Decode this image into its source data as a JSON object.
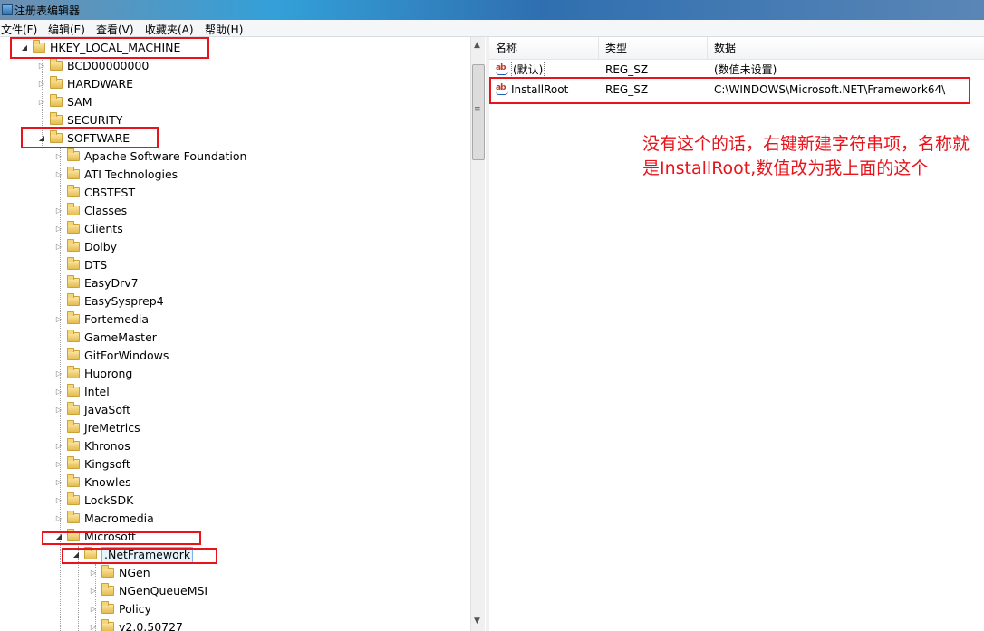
{
  "window": {
    "title": "注册表编辑器"
  },
  "menu": [
    "文件(F)",
    "编辑(E)",
    "查看(V)",
    "收藏夹(A)",
    "帮助(H)"
  ],
  "tree": {
    "root": "HKEY_LOCAL_MACHINE",
    "level1": [
      "BCD00000000",
      "HARDWARE",
      "SAM",
      "SECURITY",
      "SOFTWARE"
    ],
    "software_children": [
      "Apache Software Foundation",
      "ATI Technologies",
      "CBSTEST",
      "Classes",
      "Clients",
      "Dolby",
      "DTS",
      "EasyDrv7",
      "EasySysprep4",
      "Fortemedia",
      "GameMaster",
      "GitForWindows",
      "Huorong",
      "Intel",
      "JavaSoft",
      "JreMetrics",
      "Khronos",
      "Kingsoft",
      "Knowles",
      "LockSDK",
      "Macromedia",
      "Microsoft"
    ],
    "microsoft_children": [
      ".NetFramework"
    ],
    "netframework_children": [
      "NGen",
      "NGenQueueMSI",
      "Policy",
      "v2.0.50727"
    ]
  },
  "list": {
    "columns": [
      "名称",
      "类型",
      "数据"
    ],
    "rows": [
      {
        "name": "(默认)",
        "type": "REG_SZ",
        "data": "(数值未设置)"
      },
      {
        "name": "InstallRoot",
        "type": "REG_SZ",
        "data": "C:\\WINDOWS\\Microsoft.NET\\Framework64\\"
      }
    ]
  },
  "annotation": "没有这个的话，右键新建字符串项，名称就是InstallRoot,数值改为我上面的这个",
  "colors": {
    "highlight": "#e8141b",
    "titlebar": "#33a0d8"
  }
}
